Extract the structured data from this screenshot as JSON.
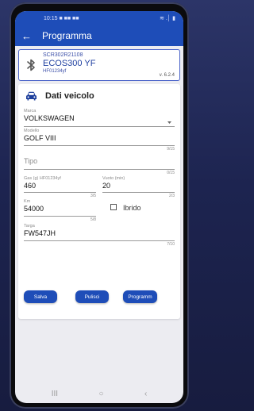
{
  "status": {
    "time": "10:15",
    "notif_icons": "■ ■■ ■■",
    "right_icons": "≋ .│ ▮"
  },
  "appbar": {
    "back_glyph": "←",
    "title": "Programma"
  },
  "device": {
    "serial": "SCR302R21108",
    "model": "ECOS300 YF",
    "gas": "HF01234yf",
    "version": "v. 6.2.4"
  },
  "vehicle": {
    "heading": "Dati veicolo",
    "marca": {
      "label": "Marca",
      "value": "VOLKSWAGEN"
    },
    "modello": {
      "label": "Modello",
      "value": "GOLF VIII",
      "counter": "9/15"
    },
    "tipo": {
      "placeholder": "Tipo",
      "counter": "0/15"
    },
    "gas": {
      "label": "Gas (g) HF01234yf",
      "value": "460",
      "counter": "3/5"
    },
    "vuoto": {
      "label": "Vuoto (min)",
      "value": "20",
      "counter": "2/3"
    },
    "km": {
      "label": "Km",
      "value": "54000",
      "counter": "5/8"
    },
    "ibrido": {
      "label": "Ibrido",
      "checked": false
    },
    "targa": {
      "label": "Targa",
      "value": "FW547JH",
      "counter": "7/10"
    }
  },
  "buttons": {
    "salva": "Salva",
    "pulisci": "Pulisci",
    "programma": "Programm"
  },
  "navbar": {
    "recent": "III",
    "home": "○",
    "back": "‹"
  },
  "colors": {
    "accent": "#1e4db8",
    "border": "#4a63c9"
  }
}
